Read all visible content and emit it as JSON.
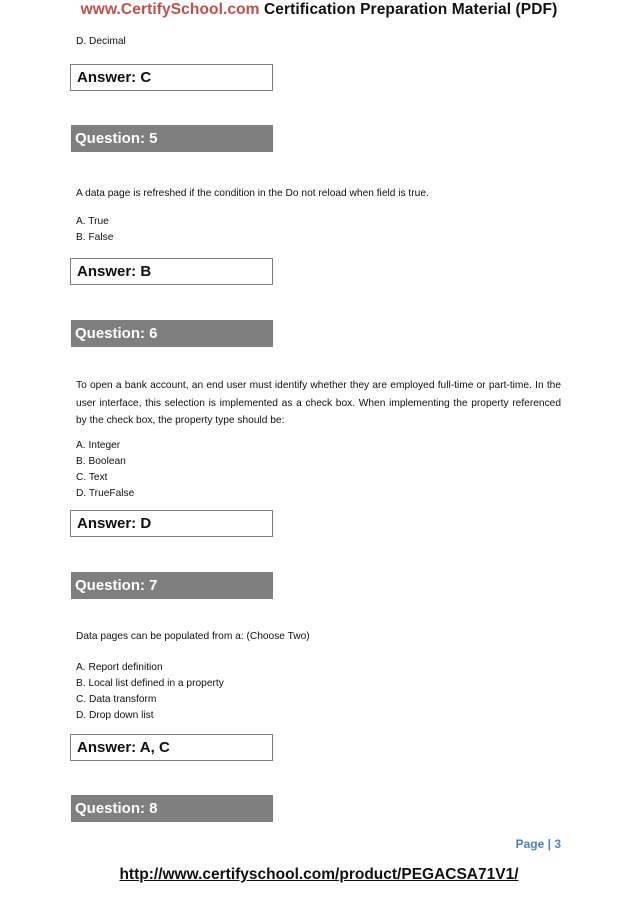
{
  "header": {
    "brand": "www.CertifySchool.com",
    "title": " Certification Preparation Material (PDF)"
  },
  "carryover_option": "D. Decimal",
  "questions": [
    {
      "number_label": "Question: 5",
      "answer_prev": "Answer: C",
      "text": "A data page is refreshed if the condition in the Do not reload when field is true.",
      "options": [
        "A. True",
        "B. False"
      ],
      "answer": "Answer: B"
    },
    {
      "number_label": "Question: 6",
      "text": "To open a bank account, an end user must identify whether they are employed full-time or part-time. In the user interface, this selection is implemented as a check box. When implementing the property referenced by the check box, the property type should be:",
      "options": [
        "A. Integer",
        "B. Boolean",
        "C. Text",
        "D. TrueFalse"
      ],
      "answer": "Answer: D"
    },
    {
      "number_label": "Question: 7",
      "text": "Data pages can be populated from a: (Choose Two)",
      "options": [
        "A. Report definition",
        "B. Local list defined in a property",
        "C. Data transform",
        "D. Drop down list"
      ],
      "answer": "Answer: A, C"
    },
    {
      "number_label": "Question: 8"
    }
  ],
  "footer": {
    "page_label": "Page | 3",
    "url": "http://www.certifyschool.com/product/PEGACSA71V1/"
  },
  "colors": {
    "brand": "#c0504d",
    "question_bar": "#7f7f7f",
    "page_number": "#4f81bd"
  }
}
